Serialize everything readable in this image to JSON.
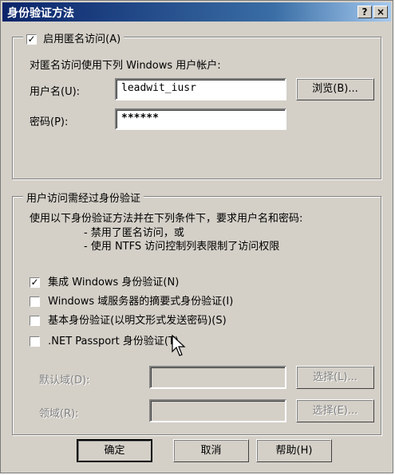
{
  "window": {
    "title": "身份验证方法",
    "help": "?",
    "close": "×"
  },
  "anonymous": {
    "checkbox_label": "启用匿名访问(A)",
    "checked": true,
    "description": "对匿名访问使用下列 Windows 用户帐户:",
    "username_label": "用户名(U):",
    "username_value": "leadwit_iusr",
    "browse_label": "浏览(B)...",
    "password_label": "密码(P):",
    "password_value": "******"
  },
  "auth": {
    "group_label": "用户访问需经过身份验证",
    "description": "使用以下身份验证方法并在下列条件下，要求用户名和密码:",
    "cond1": "- 禁用了匿名访问，或",
    "cond2": "- 使用 NTFS 访问控制列表限制了访问权限",
    "options": [
      {
        "label": "集成 Windows 身份验证(N)",
        "checked": true
      },
      {
        "label": "Windows 域服务器的摘要式身份验证(I)",
        "checked": false
      },
      {
        "label": "基本身份验证(以明文形式发送密码)(S)",
        "checked": false
      },
      {
        "label": ".NET Passport 身份验证(T)",
        "checked": false
      }
    ],
    "default_domain_label": "默认域(D):",
    "realm_label": "领域(R):",
    "select1_label": "选择(L)...",
    "select2_label": "选择(E)..."
  },
  "footer": {
    "ok": "确定",
    "cancel": "取消",
    "help": "帮助(H)"
  }
}
